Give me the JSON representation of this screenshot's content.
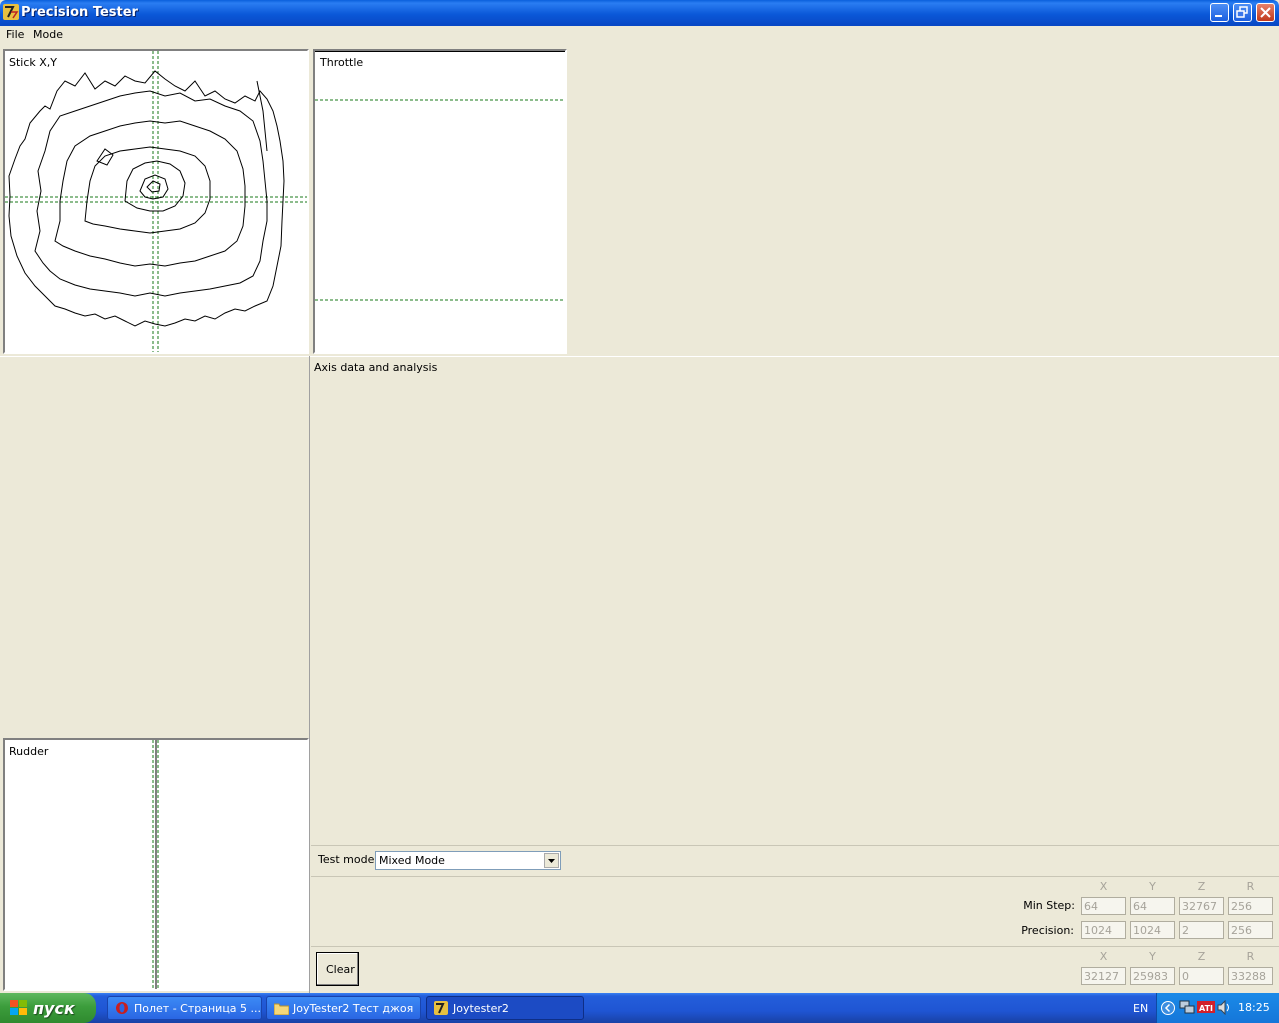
{
  "window": {
    "title": "Precision Tester"
  },
  "menu": [
    "File",
    "Mode"
  ],
  "panels": {
    "stick_label": "Stick X,Y",
    "throttle_label": "Throttle",
    "rudder_label": "Rudder",
    "axis_label": "Axis data and analysis"
  },
  "test_mode": {
    "label": "Test mode:",
    "value": "Mixed Mode"
  },
  "analysis": {
    "columns": [
      "X",
      "Y",
      "Z",
      "R"
    ],
    "min_step_label": "Min Step:",
    "min_step": [
      "64",
      "64",
      "32767",
      "256"
    ],
    "precision_label": "Precision:",
    "precision": [
      "1024",
      "1024",
      "2",
      "256"
    ],
    "current": [
      "32127",
      "25983",
      "0",
      "33288"
    ]
  },
  "clear_button": "Clear",
  "taskbar": {
    "start": "пуск",
    "tasks": [
      "Полет - Страница 5 ...",
      "JoyTester2 Тест джоя",
      "Joytester2"
    ],
    "lang": "EN",
    "clock": "18:25"
  },
  "colors": {
    "guide": "#1a7a1a",
    "titlebar": "#0a5fdc",
    "taskbar": "#245edb",
    "start": "#3c9d3c"
  }
}
